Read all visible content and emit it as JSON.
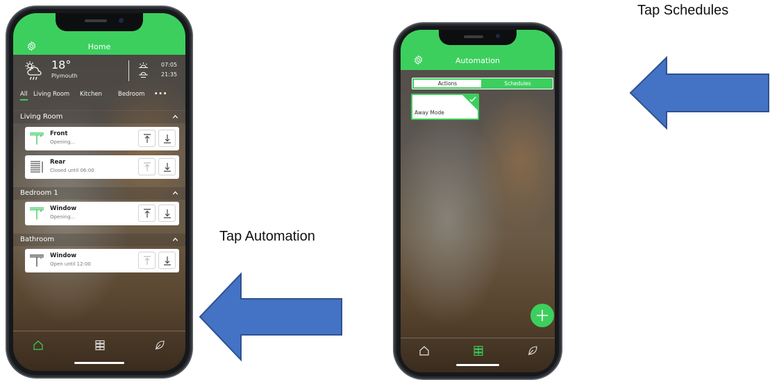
{
  "home_screen": {
    "title": "Home",
    "weather": {
      "temperature": "18°",
      "location": "Plymouth",
      "sunrise": "07:05",
      "sunset": "21:35"
    },
    "filters": [
      "All",
      "Living Room",
      "Kitchen",
      "Bedroom",
      "•••"
    ],
    "active_filter": "All",
    "rooms": [
      {
        "name": "Living Room",
        "devices": [
          {
            "name": "Front",
            "status": "Opening...",
            "icon": "blind-open-icon"
          },
          {
            "name": "Rear",
            "status": "Closed until 06:00",
            "icon": "blind-closed-icon"
          }
        ]
      },
      {
        "name": "Bedroom 1",
        "devices": [
          {
            "name": "Window",
            "status": "Opening...",
            "icon": "blind-open-icon"
          }
        ]
      },
      {
        "name": "Bathroom",
        "devices": [
          {
            "name": "Window",
            "status": "Open until 12:00",
            "icon": "blind-open-icon"
          }
        ]
      }
    ],
    "nav": [
      "home-icon",
      "grid-icon",
      "leaf-icon"
    ],
    "active_nav": "home-icon"
  },
  "automation_screen": {
    "title": "Automation",
    "tabs": [
      "Actions",
      "Schedules"
    ],
    "active_tab": "Actions",
    "actions": [
      {
        "name": "Away Mode",
        "selected": true
      }
    ],
    "nav": [
      "home-icon",
      "grid-icon",
      "leaf-icon"
    ],
    "active_nav": "grid-icon"
  },
  "annotations": {
    "tap_automation": "Tap Automation",
    "tap_schedules": "Tap Schedules"
  },
  "colors": {
    "accent_green": "#3ccf5e",
    "arrow_blue": "#4472c4",
    "arrow_outline": "#2f528f"
  }
}
